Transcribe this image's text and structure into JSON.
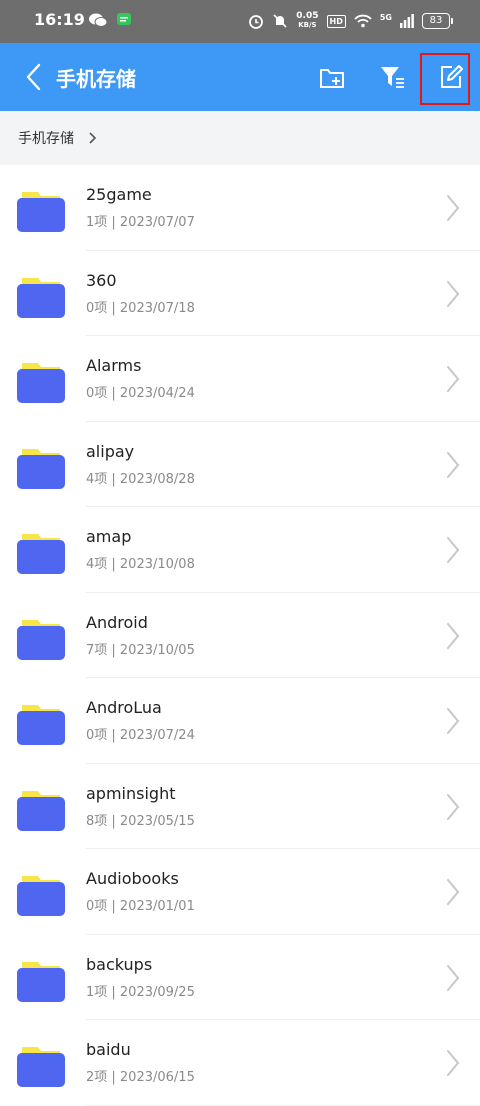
{
  "status_bar": {
    "time": "16:19",
    "speed_value": "0.05",
    "speed_unit": "KB/S",
    "hd": "HD",
    "network": "5G",
    "battery": "83"
  },
  "appbar": {
    "title": "手机存储",
    "accent": "#3d99f5"
  },
  "breadcrumb": {
    "root": "手机存储"
  },
  "folders": [
    {
      "name": "25game",
      "meta": "1项 | 2023/07/07"
    },
    {
      "name": "360",
      "meta": "0项 | 2023/07/18"
    },
    {
      "name": "Alarms",
      "meta": "0项 | 2023/04/24"
    },
    {
      "name": "alipay",
      "meta": "4项 | 2023/08/28"
    },
    {
      "name": "amap",
      "meta": "4项 | 2023/10/08"
    },
    {
      "name": "Android",
      "meta": "7项 | 2023/10/05"
    },
    {
      "name": "AndroLua",
      "meta": "0项 | 2023/07/24"
    },
    {
      "name": "apminsight",
      "meta": "8项 | 2023/05/15"
    },
    {
      "name": "Audiobooks",
      "meta": "0项 | 2023/01/01"
    },
    {
      "name": "backups",
      "meta": "1项 | 2023/09/25"
    },
    {
      "name": "baidu",
      "meta": "2项 | 2023/06/15"
    }
  ],
  "colors": {
    "folder_front": "#4f66f0",
    "folder_back": "#f6e64a",
    "highlight": "#e11818"
  }
}
